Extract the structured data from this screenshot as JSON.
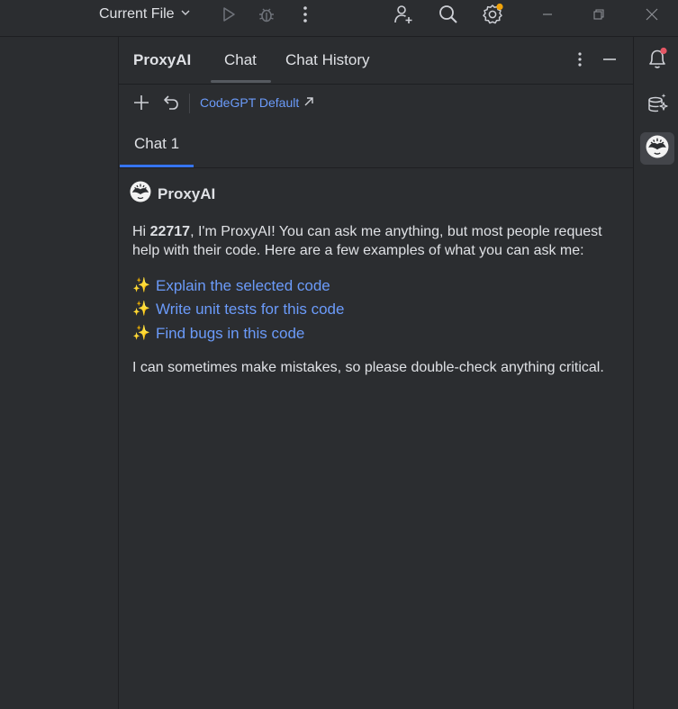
{
  "topbar": {
    "run_config_label": "Current File",
    "icons": [
      "chevron-down-icon",
      "run-icon",
      "debug-icon",
      "more-vertical-icon",
      "add-user-icon",
      "search-icon",
      "settings-icon",
      "minimize-icon",
      "restore-icon",
      "close-icon"
    ],
    "settings_badge_color": "#f0a30a"
  },
  "tool_window": {
    "title": "ProxyAI",
    "tabs": [
      {
        "label": "Chat",
        "selected": true
      },
      {
        "label": "Chat History",
        "selected": false
      }
    ],
    "actions": [
      "more-vertical-icon",
      "hide-icon"
    ]
  },
  "toolbar": {
    "actions": [
      "plus-icon",
      "undo-icon"
    ],
    "model_label": "CodeGPT Default",
    "model_link_icon": "arrow-up-right-icon",
    "accent_color": "#6b9bfa"
  },
  "session_tabs": [
    {
      "label": "Chat 1",
      "selected": true
    }
  ],
  "message": {
    "author": "ProxyAI",
    "greeting_prefix": "Hi ",
    "user_id": "22717",
    "greeting_rest": ", I'm ProxyAI! You can ask me anything, but most people request help with their code. Here are a few examples of what you can ask me:",
    "suggestions": [
      {
        "icon": "sparkles-icon",
        "label": "Explain the selected code"
      },
      {
        "icon": "sparkles-icon",
        "label": "Write unit tests for this code"
      },
      {
        "icon": "sparkles-icon",
        "label": "Find bugs in this code"
      }
    ],
    "disclaimer": "I can sometimes make mistakes, so please double-check anything critical."
  },
  "right_strip": {
    "items": [
      "notifications-icon",
      "ai-assistant-icon",
      "proxyai-icon"
    ],
    "notification_badge_color": "#e55765"
  },
  "colors": {
    "background": "#2b2d30",
    "text": "#dfe1e5",
    "link": "#6b9bfa",
    "selected_tab_underline": "#3574f0"
  }
}
